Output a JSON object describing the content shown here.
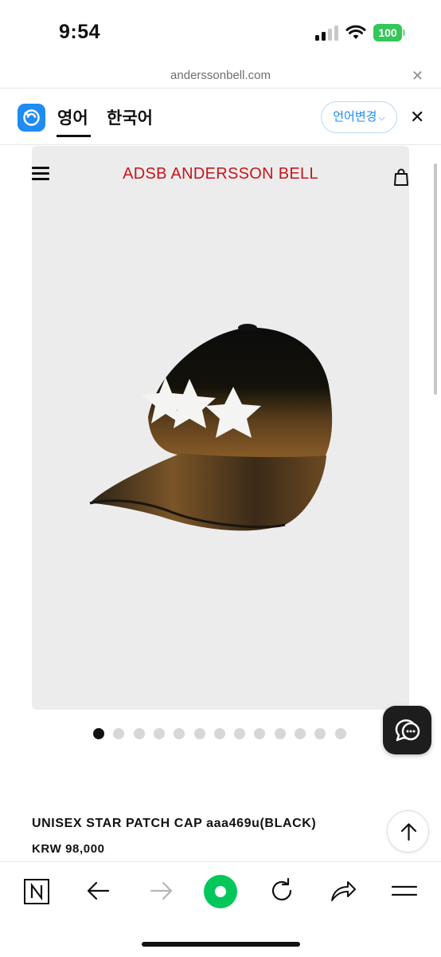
{
  "status_bar": {
    "time": "9:54",
    "battery": "100"
  },
  "browser": {
    "url": "anderssonbell.com"
  },
  "translate_bar": {
    "tab_english": "영어",
    "tab_korean": "한국어",
    "change_language": "언어변경"
  },
  "header": {
    "brand": "ADSB  ANDERSSON BELL"
  },
  "product": {
    "name": "UNISEX STAR PATCH CAP aaa469u(BLACK)",
    "price": "KRW 98,000",
    "image_index": 1,
    "image_count": 13
  },
  "icons": {
    "menu": "hamburger-menu-icon",
    "bag": "shopping-bag-icon",
    "chat": "chat-icon",
    "top": "arrow-up-icon",
    "toolbar": [
      "naver-icon",
      "back-arrow-icon",
      "forward-arrow-icon",
      "green-circle-icon",
      "reload-icon",
      "share-icon",
      "menu-lines-icon"
    ]
  },
  "colors": {
    "brand_red": "#c4161c",
    "accent_blue": "#1f8bf3",
    "toolbar_green": "#03c75a",
    "battery_green": "#34c759"
  }
}
